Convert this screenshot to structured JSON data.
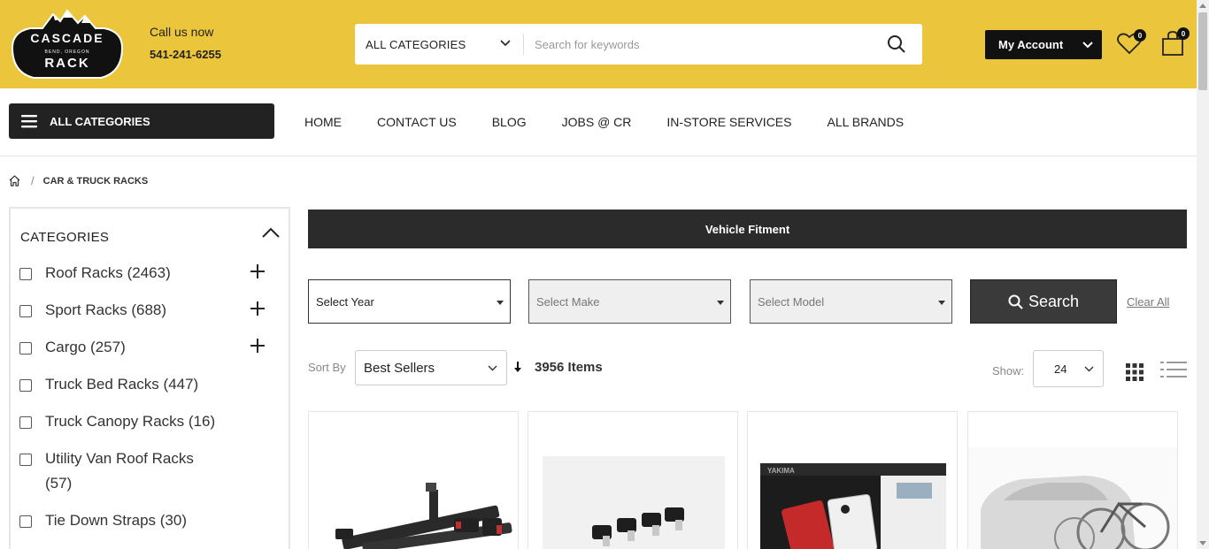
{
  "header": {
    "logo": {
      "line1": "CASCADE",
      "line2": "BEND, OREGON",
      "line3": "RACK"
    },
    "call_label": "Call us now",
    "phone": "541-241-6255",
    "search": {
      "category": "ALL CATEGORIES",
      "placeholder": "Search for keywords"
    },
    "account_label": "My Account",
    "wishlist_count": "0",
    "cart_count": "0",
    "colors": {
      "bar": "#ebc63c",
      "dark": "#111111"
    }
  },
  "nav": {
    "all_categories": "ALL CATEGORIES",
    "links": [
      "HOME",
      "CONTACT US",
      "BLOG",
      "JOBS @ CR",
      "IN-STORE SERVICES",
      "ALL BRANDS"
    ]
  },
  "breadcrumb": {
    "current": "CAR & TRUCK RACKS"
  },
  "sidebar": {
    "title": "CATEGORIES",
    "items": [
      {
        "label": "Roof Racks",
        "count": "(2463)",
        "expandable": true
      },
      {
        "label": "Sport Racks",
        "count": "(688)",
        "expandable": true
      },
      {
        "label": "Cargo",
        "count": "(257)",
        "expandable": true
      },
      {
        "label": "Truck Bed Racks",
        "count": "(447)",
        "expandable": false
      },
      {
        "label": "Truck Canopy Racks",
        "count": "(16)",
        "expandable": false
      },
      {
        "label": "Utility Van Roof Racks",
        "count": "(57)",
        "expandable": false
      },
      {
        "label": "Tie Down Straps",
        "count": "(30)",
        "expandable": false
      }
    ]
  },
  "fitment": {
    "title": "Vehicle Fitment",
    "year_placeholder": "Select Year",
    "make_placeholder": "Select Make",
    "model_placeholder": "Select Model",
    "search_label": "Search",
    "clear_label": "Clear All"
  },
  "listing": {
    "sort_label": "Sort By",
    "sort_value": "Best Sellers",
    "item_count": "3956 Items",
    "show_label": "Show:",
    "show_value": "24"
  },
  "products": [
    {
      "image": "bike-hitch-rack-image"
    },
    {
      "image": "rack-mount-hardware-image"
    },
    {
      "image": "truck-bed-cargo-image"
    },
    {
      "image": "car-bike-rack-image"
    }
  ]
}
